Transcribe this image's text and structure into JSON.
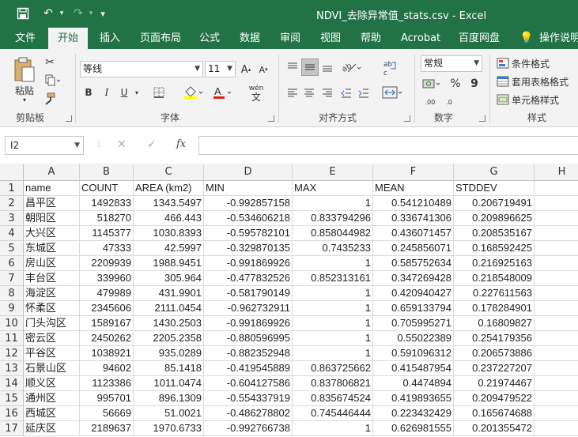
{
  "titlebar": {
    "title": "NDVI_去除异常值_stats.csv  -  Excel",
    "save_icon": "💾",
    "undo_icon": "↶",
    "redo_icon": "↷",
    "customize_icon": "▾"
  },
  "tabs": [
    "文件",
    "开始",
    "插入",
    "页面布局",
    "公式",
    "数据",
    "审阅",
    "视图",
    "帮助",
    "Acrobat",
    "百度网盘",
    "操作说明"
  ],
  "active_tab": "开始",
  "ribbon": {
    "clipboard": {
      "paste_label": "粘贴",
      "group_label": "剪贴板"
    },
    "font": {
      "font_name": "等线",
      "font_size": "11",
      "bold": "B",
      "italic": "I",
      "underline": "U",
      "group_label": "字体",
      "wen": "wén",
      "wen_char": "文"
    },
    "alignment": {
      "group_label": "对齐方式"
    },
    "number": {
      "format": "常规",
      "percent": "%",
      "comma": "9",
      "group_label": "数字",
      "dec_inc": ".00",
      "dec_dec": ".0"
    },
    "styles": {
      "conditional": "条件格式",
      "table": "套用表格格式",
      "cell": "单元格样式",
      "group_label": "样式"
    }
  },
  "formula_bar": {
    "name_box": "I2",
    "cancel": "✕",
    "enter": "✓",
    "fx": "fx",
    "value": ""
  },
  "colors": {
    "excel_green": "#217346"
  },
  "columns": [
    "A",
    "B",
    "C",
    "D",
    "E",
    "F",
    "G",
    "H"
  ],
  "rows": [
    [
      "name",
      "COUNT",
      "AREA (km2)",
      "MIN",
      "MAX",
      "MEAN",
      "STDDEV"
    ],
    [
      "昌平区",
      "1492833",
      "1343.5497",
      "-0.992857158",
      "1",
      "0.541210489",
      "0.206719491"
    ],
    [
      "朝阳区",
      "518270",
      "466.443",
      "-0.534606218",
      "0.833794296",
      "0.336741306",
      "0.209896625"
    ],
    [
      "大兴区",
      "1145377",
      "1030.8393",
      "-0.595782101",
      "0.858044982",
      "0.436071457",
      "0.208535167"
    ],
    [
      "东城区",
      "47333",
      "42.5997",
      "-0.329870135",
      "0.7435233",
      "0.245856071",
      "0.168592425"
    ],
    [
      "房山区",
      "2209939",
      "1988.9451",
      "-0.991869926",
      "1",
      "0.585752634",
      "0.216925163"
    ],
    [
      "丰台区",
      "339960",
      "305.964",
      "-0.477832526",
      "0.852313161",
      "0.347269428",
      "0.218548009"
    ],
    [
      "海淀区",
      "479989",
      "431.9901",
      "-0.581790149",
      "1",
      "0.420940427",
      "0.227611563"
    ],
    [
      "怀柔区",
      "2345606",
      "2111.0454",
      "-0.962732911",
      "1",
      "0.659133794",
      "0.178284901"
    ],
    [
      "门头沟区",
      "1589167",
      "1430.2503",
      "-0.991869926",
      "1",
      "0.705995271",
      "0.16809827"
    ],
    [
      "密云区",
      "2450262",
      "2205.2358",
      "-0.880596995",
      "1",
      "0.55022389",
      "0.254179356"
    ],
    [
      "平谷区",
      "1038921",
      "935.0289",
      "-0.882352948",
      "1",
      "0.591096312",
      "0.206573886"
    ],
    [
      "石景山区",
      "94602",
      "85.1418",
      "-0.419545889",
      "0.863725662",
      "0.415487954",
      "0.237227207"
    ],
    [
      "顺义区",
      "1123386",
      "1011.0474",
      "-0.604127586",
      "0.837806821",
      "0.4474894",
      "0.21974467"
    ],
    [
      "通州区",
      "995701",
      "896.1309",
      "-0.554337919",
      "0.835674524",
      "0.419893655",
      "0.209479522"
    ],
    [
      "西城区",
      "56669",
      "51.0021",
      "-0.486278802",
      "0.745446444",
      "0.223432429",
      "0.165674688"
    ],
    [
      "延庆区",
      "2189637",
      "1970.6733",
      "-0.992766738",
      "1",
      "0.626981555",
      "0.201355472"
    ]
  ]
}
